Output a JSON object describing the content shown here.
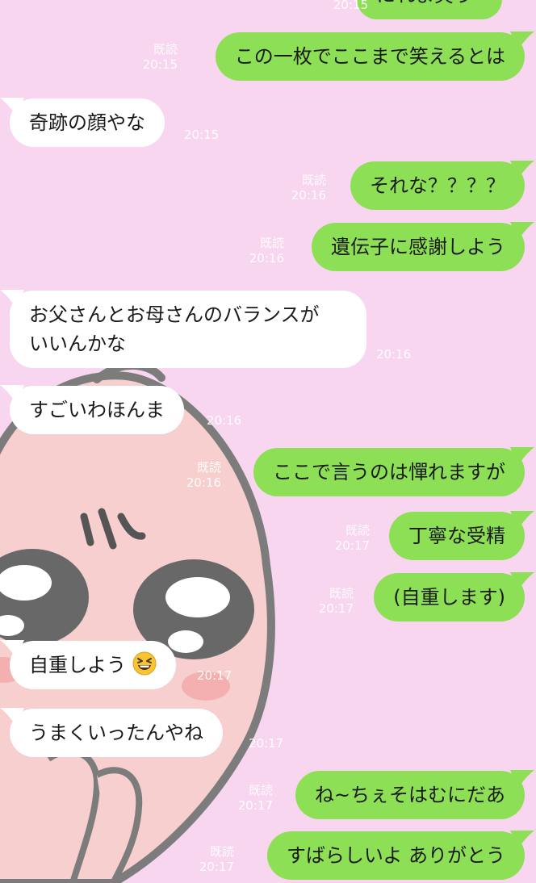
{
  "colors": {
    "background": "#f8d6ef",
    "outgoing_bubble": "#8de055",
    "incoming_bubble": "#ffffff",
    "meta_text": "#ffffff"
  },
  "messages": [
    {
      "direction": "out",
      "text": "にれま笑う",
      "read_label": "",
      "time": "20:15"
    },
    {
      "direction": "out",
      "text": "この一枚でここまで笑えるとは",
      "read_label": "既読",
      "time": "20:15"
    },
    {
      "direction": "in",
      "text": "奇跡の顔やな",
      "time": "20:15"
    },
    {
      "direction": "out",
      "text": "それな？？？？",
      "read_label": "既読",
      "time": "20:16"
    },
    {
      "direction": "out",
      "text": "遺伝子に感謝しよう",
      "read_label": "既読",
      "time": "20:16"
    },
    {
      "direction": "in",
      "text_lines": [
        "お父さんとお母さんのバランスが",
        "いいんかな"
      ],
      "time": "20:16"
    },
    {
      "direction": "in",
      "text": "すごいわほんま",
      "time": "20:16"
    },
    {
      "direction": "out",
      "text": "ここで言うのは憚れますが",
      "read_label": "既読",
      "time": "20:16"
    },
    {
      "direction": "out",
      "text": "丁寧な受精",
      "read_label": "既読",
      "time": "20:17"
    },
    {
      "direction": "out",
      "text": "(自重します)",
      "read_label": "既読",
      "time": "20:17"
    },
    {
      "direction": "in",
      "text": "自重しよう",
      "emoji": "grinning-squinting-face",
      "time": "20:17"
    },
    {
      "direction": "in",
      "text": "うまくいったんやね",
      "time": "20:17"
    },
    {
      "direction": "out",
      "text": "ね~ちぇそはむにだあ",
      "read_label": "既読",
      "time": "20:17"
    },
    {
      "direction": "out",
      "text": "すばらしいよ ありがとう",
      "read_label": "既読",
      "time": "20:17"
    }
  ],
  "icons": {
    "wallpaper": "peach-character-wallpaper",
    "emoji": "grinning-squinting-face-emoji"
  }
}
